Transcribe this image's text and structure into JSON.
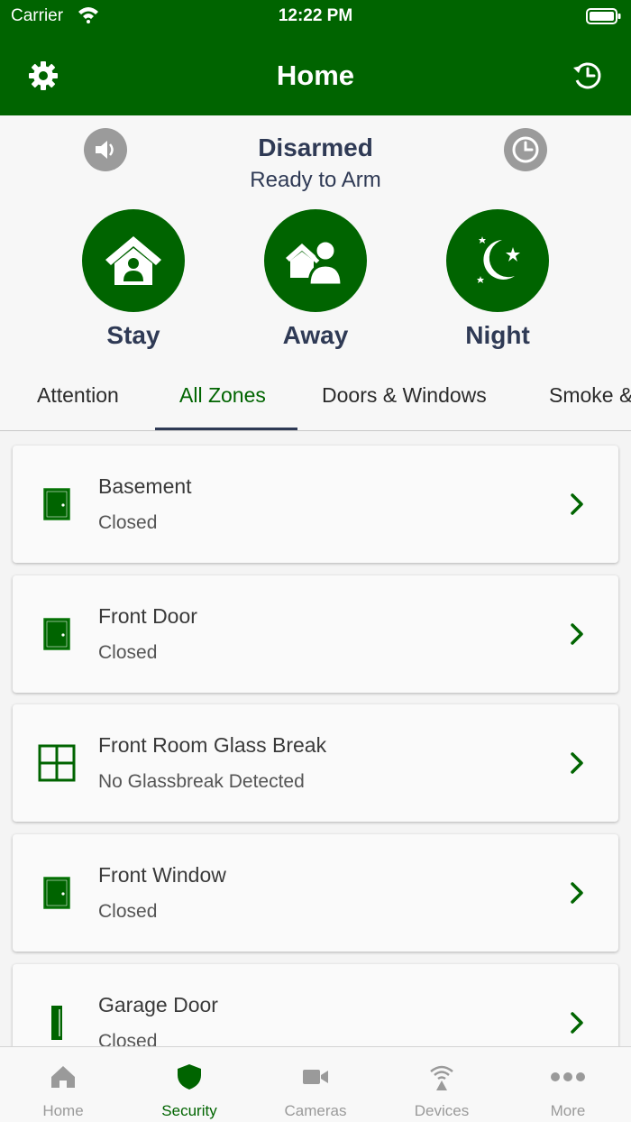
{
  "status_bar": {
    "carrier": "Carrier",
    "time": "12:22 PM"
  },
  "nav": {
    "title": "Home",
    "left_icon": "gear-icon",
    "right_icon": "history-icon"
  },
  "arm": {
    "title": "Disarmed",
    "subtitle": "Ready to Arm",
    "left_icon": "speaker-icon",
    "right_icon": "clock-icon",
    "modes": [
      {
        "label": "Stay",
        "icon": "stay-home-icon"
      },
      {
        "label": "Away",
        "icon": "away-icon"
      },
      {
        "label": "Night",
        "icon": "night-icon"
      }
    ]
  },
  "tabs": [
    {
      "label": "Attention",
      "active": false
    },
    {
      "label": "All Zones",
      "active": true
    },
    {
      "label": "Doors & Windows",
      "active": false
    },
    {
      "label": "Smoke & CO",
      "active": false
    }
  ],
  "zones": [
    {
      "name": "Basement",
      "status": "Closed",
      "icon": "door-icon"
    },
    {
      "name": "Front Door",
      "status": "Closed",
      "icon": "door-icon"
    },
    {
      "name": "Front Room Glass Break",
      "status": "No Glassbreak Detected",
      "icon": "glass-break-icon"
    },
    {
      "name": "Front Window",
      "status": "Closed",
      "icon": "door-icon"
    },
    {
      "name": "Garage Door",
      "status": "Closed",
      "icon": "garage-door-icon"
    }
  ],
  "tabbar": [
    {
      "label": "Home",
      "icon": "home-icon",
      "active": false
    },
    {
      "label": "Security",
      "icon": "shield-icon",
      "active": true
    },
    {
      "label": "Cameras",
      "icon": "camera-icon",
      "active": false
    },
    {
      "label": "Devices",
      "icon": "devices-icon",
      "active": false
    },
    {
      "label": "More",
      "icon": "more-icon",
      "active": false
    }
  ],
  "colors": {
    "brand_green": "#006400",
    "title_navy": "#2f3a55",
    "inactive_gray": "#9a9a9a"
  }
}
